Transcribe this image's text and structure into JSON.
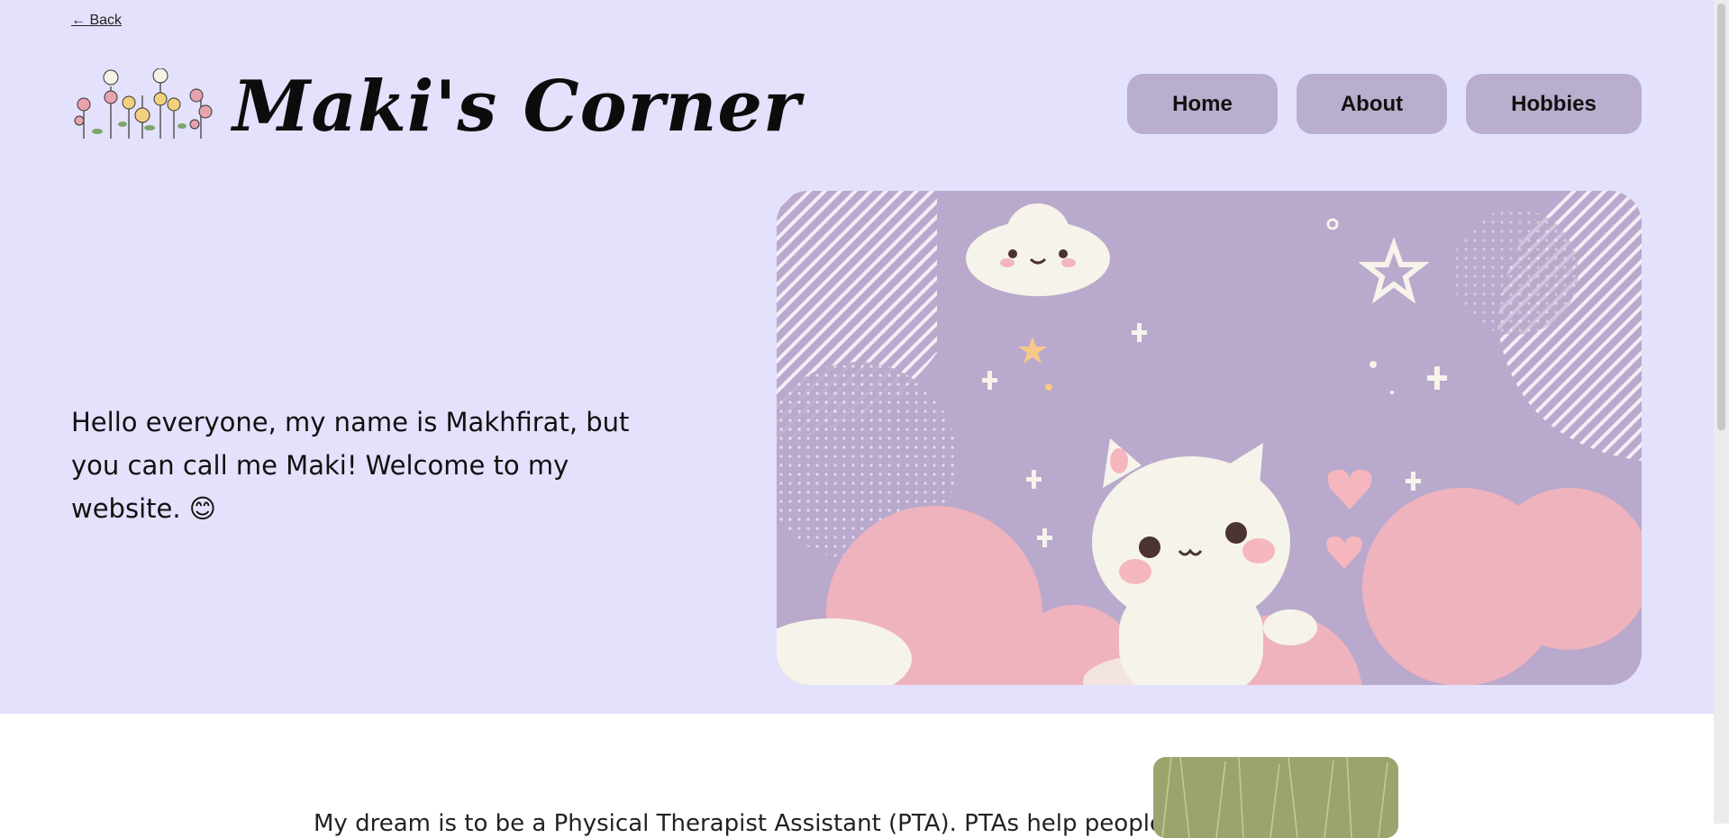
{
  "header": {
    "back_label": "← Back",
    "title": "Maki's Corner"
  },
  "nav": {
    "items": [
      {
        "label": "Home"
      },
      {
        "label": "About"
      },
      {
        "label": "Hobbies"
      }
    ]
  },
  "intro": {
    "text": "Hello everyone, my name is Makhfirat, but you can call me Maki! Welcome to my website. 😊"
  },
  "section": {
    "text": "My dream is to be a Physical Therapist Assistant (PTA). PTAs help people to"
  },
  "colors": {
    "hero_bg": "#e3e1fb",
    "nav_button": "#b9aecd",
    "art_bg": "#b9a9cc",
    "clouds": "#efb3bd"
  }
}
